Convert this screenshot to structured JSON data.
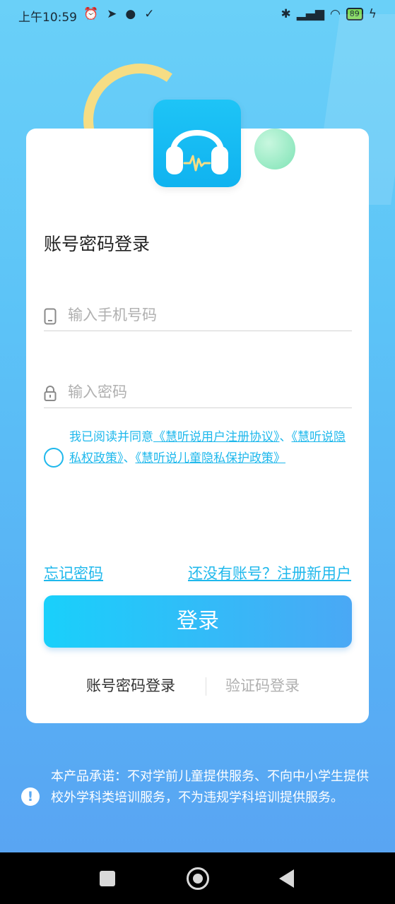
{
  "status_bar": {
    "time": "上午10:59",
    "battery": "89"
  },
  "login": {
    "title": "账号密码登录",
    "phone_placeholder": "输入手机号码",
    "password_placeholder": "输入密码",
    "agreement_prefix": "我已阅读并同意",
    "agreement_link1": "《慧听说用户注册协议》",
    "separator1": "、",
    "agreement_link2": "《慧听说隐私权政策》",
    "separator2": "、",
    "agreement_link3": "《慧听说儿童隐私保护政策》",
    "forgot_password": "忘记密码",
    "register": "还没有账号？注册新用户",
    "login_button": "登录",
    "mode_password": "账号密码登录",
    "mode_code": "验证码登录"
  },
  "notice": {
    "icon": "!",
    "text": "本产品承诺：不对学前儿童提供服务、不向中小学生提供校外学科类培训服务，不为违规学科培训提供服务。"
  },
  "colors": {
    "accent": "#1fb8ec",
    "background": "#5cc3f7"
  }
}
